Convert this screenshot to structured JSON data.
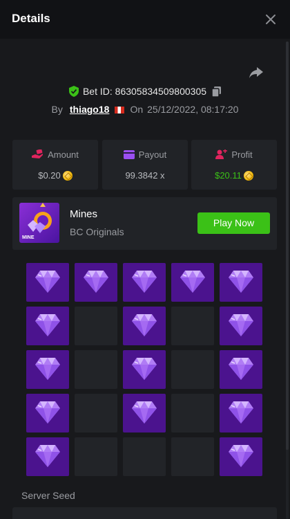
{
  "header": {
    "title": "Details"
  },
  "bet": {
    "id_label": "Bet ID: 86305834509800305",
    "by_label": "By",
    "username": "thiago18",
    "on_label": "On",
    "datetime": "25/12/2022, 08:17:20"
  },
  "stats": [
    {
      "label": "Amount",
      "value": "$0.20",
      "icon": "money-hand-icon",
      "coin": true
    },
    {
      "label": "Payout",
      "value": "99.3842 x",
      "icon": "wallet-icon",
      "coin": false
    },
    {
      "label": "Profit",
      "value": "$20.11",
      "icon": "profit-icon",
      "coin": true
    }
  ],
  "game": {
    "name": "Mines",
    "provider": "BC Originals",
    "thumb_text": "MINE",
    "play_label": "Play Now"
  },
  "mines_grid": [
    [
      "gem",
      "gem",
      "gem",
      "gem",
      "gem"
    ],
    [
      "gem",
      "empty",
      "gem",
      "empty",
      "gem"
    ],
    [
      "gem",
      "empty",
      "gem",
      "empty",
      "gem"
    ],
    [
      "gem",
      "empty",
      "gem",
      "empty",
      "gem"
    ],
    [
      "gem",
      "empty",
      "empty",
      "empty",
      "gem"
    ]
  ],
  "server_seed": {
    "label": "Server Seed"
  },
  "colors": {
    "accent_green": "#3bc117",
    "gem_cell": "#4b138e",
    "empty_cell": "#222428",
    "panel": "#212327",
    "background": "#18191c"
  }
}
